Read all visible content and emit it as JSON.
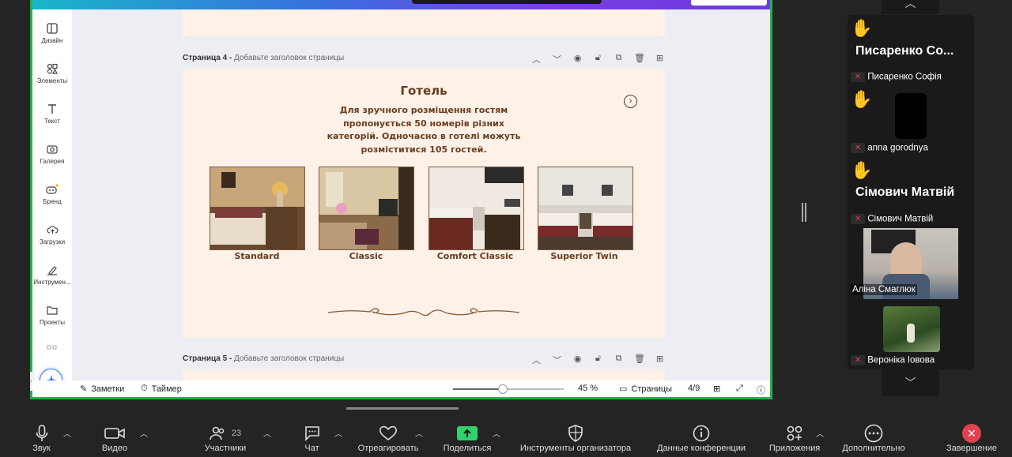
{
  "sidebar": {
    "items": [
      {
        "label": "Дизайн",
        "icon": "layout-icon"
      },
      {
        "label": "Элементы",
        "icon": "shapes-icon"
      },
      {
        "label": "Текст",
        "icon": "text-icon"
      },
      {
        "label": "Галерея",
        "icon": "camera-icon"
      },
      {
        "label": "Бренд",
        "icon": "brand-icon"
      },
      {
        "label": "Загрузки",
        "icon": "upload-cloud-icon"
      },
      {
        "label": "Инструмен...",
        "icon": "pen-icon"
      },
      {
        "label": "Проекты",
        "icon": "folder-icon"
      }
    ]
  },
  "page4": {
    "label": "Страница 4 - ",
    "subtitle": "Добавьте заголовок страницы"
  },
  "page5": {
    "label": "Страница 5 - ",
    "subtitle": "Добавьте заголовок страницы"
  },
  "slide": {
    "title": "Готель",
    "text": "Для зручного розміщення гостям пропонується 50 номерів різних категорій. Одночасно в готелі можуть розміститися 105 гостей.",
    "rooms": [
      {
        "label": "Standard"
      },
      {
        "label": "Classic"
      },
      {
        "label": "Comfort Classic"
      },
      {
        "label": "Superior Twin"
      }
    ]
  },
  "bottom": {
    "notes": "Заметки",
    "timer": "Таймер",
    "zoom": "45 %",
    "zoom_level": 0.45,
    "pages": "Страницы",
    "page_count": "4/9"
  },
  "toolbar": {
    "items": [
      {
        "label": "Звук",
        "icon": "microphone-icon"
      },
      {
        "label": "Видео",
        "icon": "video-camera-icon"
      },
      {
        "label": "Участники",
        "icon": "participants-icon",
        "count": "23"
      },
      {
        "label": "Чат",
        "icon": "chat-icon"
      },
      {
        "label": "Отреагировать",
        "icon": "heart-icon"
      },
      {
        "label": "Поделиться",
        "icon": "share-screen-icon"
      },
      {
        "label": "Инструменты организатора",
        "icon": "shield-icon"
      },
      {
        "label": "Данные конференции",
        "icon": "info-icon"
      },
      {
        "label": "Приложения",
        "icon": "apps-icon"
      },
      {
        "label": "Дополнительно",
        "icon": "more-icon"
      },
      {
        "label": "Завершение",
        "icon": "end-call-icon"
      }
    ]
  },
  "participants": {
    "tiles": [
      {
        "big": "Писаренко   Co...",
        "name": "Писаренко Софія"
      },
      {
        "name": "anna gorodnya"
      },
      {
        "big": "Сімович Матвій",
        "name": "Сімович Матвій"
      },
      {
        "name": "Аліна Смаглюк"
      },
      {
        "name": "Вероніка Іовова"
      }
    ]
  },
  "colors": {
    "accent_green": "#22b14c",
    "slide_bg": "#fdf1e8",
    "brown_text": "#6b3c1c",
    "end_red": "#e0424f",
    "share_green": "#2fd36b"
  }
}
